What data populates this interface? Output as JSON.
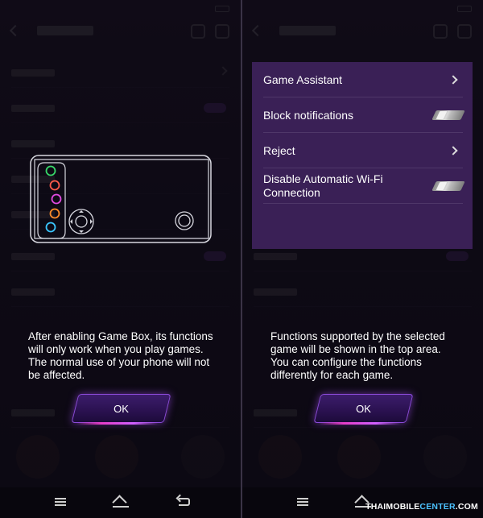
{
  "left_screen": {
    "guide_text": "After enabling Game Box, its functions will only work when you play games. The normal use of your phone will not be affected.",
    "ok_label": "OK"
  },
  "right_screen": {
    "panel": {
      "items": [
        {
          "label": "Game Assistant",
          "control": "chevron"
        },
        {
          "label": "Block notifications",
          "control": "toggle",
          "state": "off"
        },
        {
          "label": "Reject",
          "control": "chevron"
        },
        {
          "label": "Disable Automatic Wi-Fi Connection",
          "control": "toggle",
          "state": "off"
        }
      ]
    },
    "guide_text": "Functions supported by the selected game will be shown in the top area. You can configure the functions differently for each game.",
    "ok_label": "OK"
  },
  "watermark": {
    "part1": "THAIMOBILE",
    "part2": "CENTER",
    "part3": ".COM"
  },
  "colors": {
    "panel_bg": "#3a2056",
    "button_glow": "#8b4bd8",
    "accent_pink": "#e63cc8",
    "watermark_accent": "#4cc2ff"
  },
  "icons": [
    "menu-icon",
    "home-icon",
    "back-icon",
    "chevron-right-icon",
    "toggle-switch"
  ]
}
